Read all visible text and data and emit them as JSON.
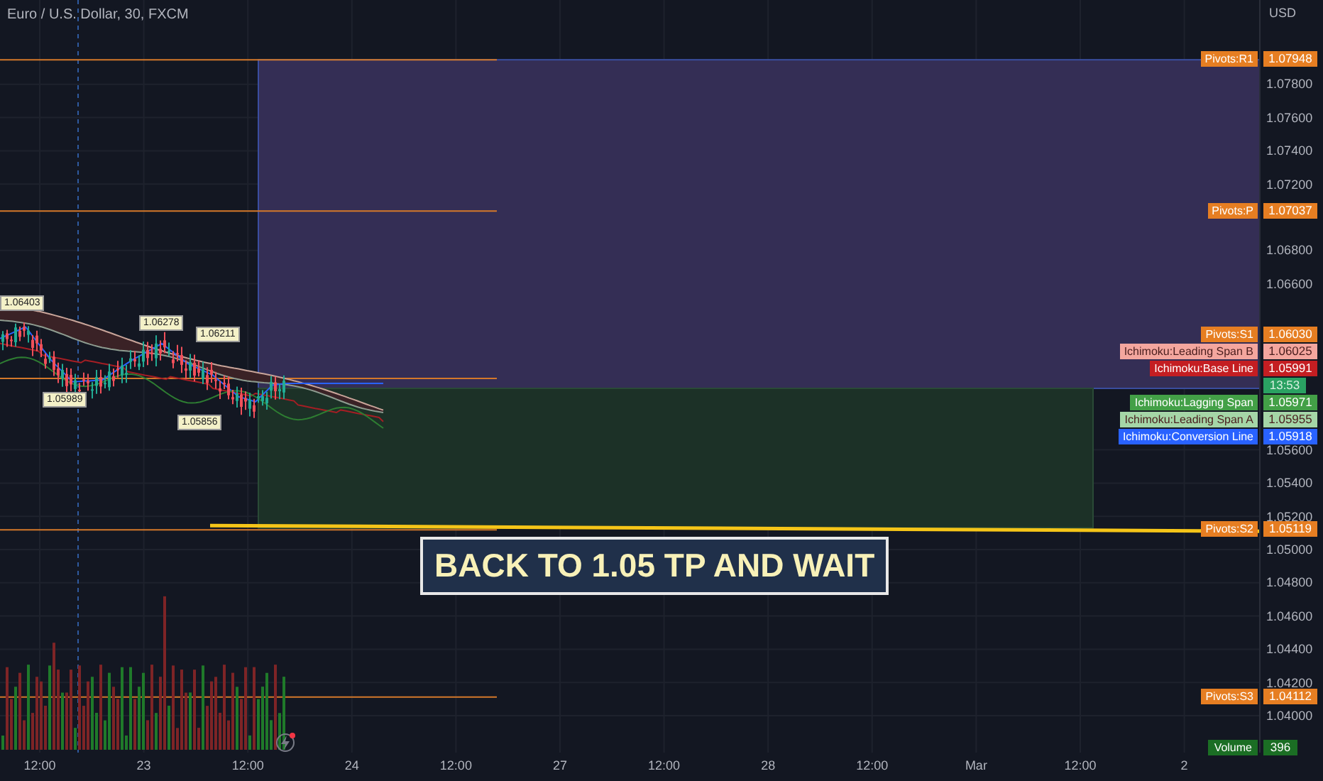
{
  "chart": {
    "title": "Euro / U.S. Dollar, 30, FXCM",
    "currency": "USD",
    "high_low_labels": [
      {
        "value": "1.06403"
      },
      {
        "value": "1.06278"
      },
      {
        "value": "1.06211"
      },
      {
        "value": "1.05989"
      },
      {
        "value": "1.05856"
      }
    ],
    "annotation": {
      "text": "BACK TO 1.05 TP AND WAIT"
    }
  },
  "price_axis": {
    "ticks": [
      "1.07800",
      "1.07600",
      "1.07400",
      "1.07200",
      "1.06800",
      "1.06600",
      "1.05600",
      "1.05400",
      "1.05200",
      "1.05000",
      "1.04800",
      "1.04600",
      "1.04400",
      "1.04200",
      "1.04000"
    ]
  },
  "price_tags": [
    {
      "kind": "tag",
      "label": "Pivots:R1",
      "value": "1.07948",
      "color": "#e67e22"
    },
    {
      "kind": "tag",
      "label": "Pivots:P",
      "value": "1.07037",
      "color": "#e67e22"
    },
    {
      "kind": "tag",
      "label": "Pivots:S1",
      "value": "1.06030",
      "color": "#e67e22"
    },
    {
      "kind": "tag",
      "label": "Ichimoku:Leading Span B",
      "value": "1.06025",
      "color": "#f4a69e"
    },
    {
      "kind": "tag",
      "label": "Ichimoku:Base Line",
      "value": "1.05991",
      "color": "#c41e22"
    },
    {
      "kind": "countdown",
      "value": "13:53",
      "color": "#2aa162"
    },
    {
      "kind": "tag",
      "label": "Ichimoku:Lagging Span",
      "value": "1.05971",
      "color": "#43a047"
    },
    {
      "kind": "tag",
      "label": "Ichimoku:Leading Span A",
      "value": "1.05955",
      "color": "#a5d6a7"
    },
    {
      "kind": "tag",
      "label": "Ichimoku:Conversion Line",
      "value": "1.05918",
      "color": "#2962ff"
    },
    {
      "kind": "tag",
      "label": "Pivots:S2",
      "value": "1.05119",
      "color": "#e67e22"
    },
    {
      "kind": "tag",
      "label": "Pivots:S3",
      "value": "1.04112",
      "color": "#e67e22"
    }
  ],
  "volume_tag": {
    "label": "Volume",
    "value": "396"
  },
  "time_axis": {
    "labels": [
      "12:00",
      "23",
      "12:00",
      "24",
      "12:00",
      "27",
      "12:00",
      "28",
      "12:00",
      "Mar",
      "12:00",
      "2"
    ]
  }
}
